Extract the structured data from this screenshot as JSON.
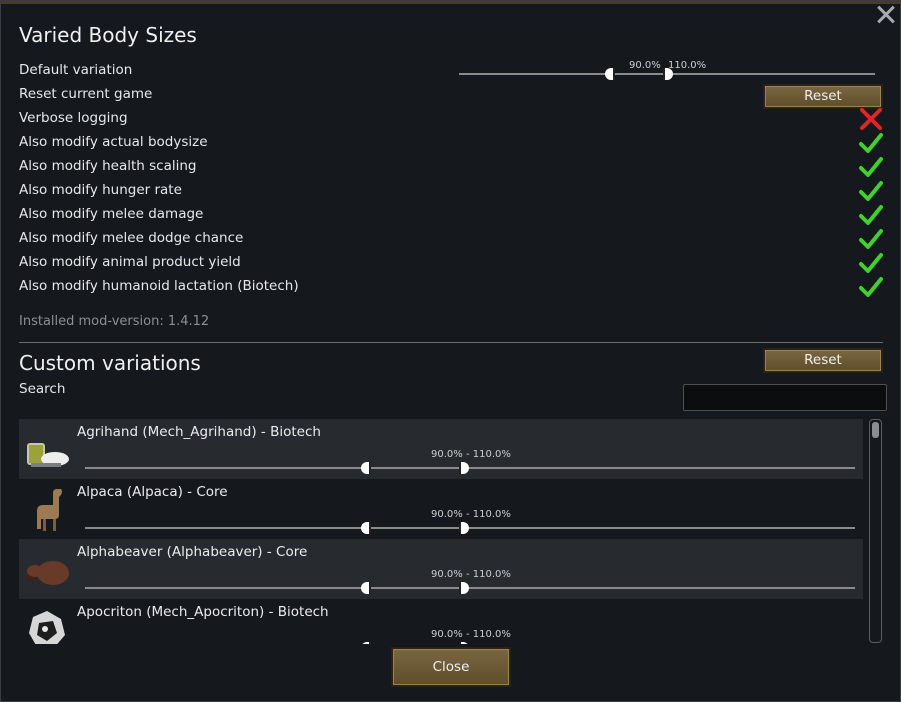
{
  "dialog": {
    "title": "Varied Body Sizes",
    "close_icon": "close-icon"
  },
  "settings": {
    "default_variation": {
      "label": "Default variation",
      "min_label": "90.0%",
      "max_label": "110.0%",
      "min_value": 90.0,
      "max_value": 110.0
    },
    "reset_game": {
      "label": "Reset current game",
      "button": "Reset"
    },
    "options": [
      {
        "label": "Verbose logging",
        "checked": false
      },
      {
        "label": "Also modify actual bodysize",
        "checked": true
      },
      {
        "label": "Also modify health scaling",
        "checked": true
      },
      {
        "label": "Also modify hunger rate",
        "checked": true
      },
      {
        "label": "Also modify melee damage",
        "checked": true
      },
      {
        "label": "Also modify melee dodge chance",
        "checked": true
      },
      {
        "label": "Also modify animal product yield",
        "checked": true
      },
      {
        "label": "Also modify humanoid lactation (Biotech)",
        "checked": true
      }
    ],
    "version": "Installed mod-version: 1.4.12"
  },
  "custom": {
    "title": "Custom variations",
    "reset_button": "Reset",
    "search_label": "Search",
    "search_value": "",
    "items": [
      {
        "name": "Agrihand (Mech_Agrihand) - Biotech",
        "range": "90.0% - 110.0%",
        "icon": "agrihand-icon"
      },
      {
        "name": "Alpaca (Alpaca) - Core",
        "range": "90.0% - 110.0%",
        "icon": "alpaca-icon"
      },
      {
        "name": "Alphabeaver (Alphabeaver) - Core",
        "range": "90.0% - 110.0%",
        "icon": "alphabeaver-icon"
      },
      {
        "name": "Apocriton (Mech_Apocriton) - Biotech",
        "range": "90.0% - 110.0%",
        "icon": "apocriton-icon"
      }
    ]
  },
  "footer": {
    "close_button": "Close"
  },
  "colors": {
    "check": "#3fd12c",
    "cross": "#e0242a",
    "button": "#6e5a36"
  }
}
